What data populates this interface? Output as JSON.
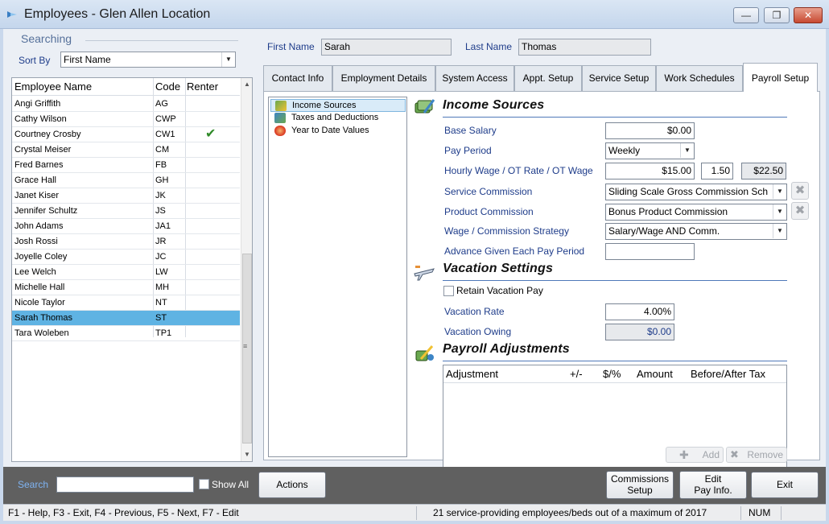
{
  "window": {
    "title": "Employees - Glen Allen Location",
    "minimize": "—",
    "maximize": "❐",
    "close": "✕"
  },
  "search_panel": {
    "group_label": "Searching",
    "sort_by_label": "Sort By",
    "sort_by_value": "First Name"
  },
  "employee_grid": {
    "columns": [
      "Employee Name",
      "Code",
      "Renter"
    ],
    "rows": [
      {
        "name": "Angi Griffith",
        "code": "AG",
        "renter": false
      },
      {
        "name": "Cathy Wilson",
        "code": "CWP",
        "renter": false
      },
      {
        "name": "Courtney Crosby",
        "code": "CW1",
        "renter": true
      },
      {
        "name": "Crystal Meiser",
        "code": "CM",
        "renter": false
      },
      {
        "name": "Fred Barnes",
        "code": "FB",
        "renter": false
      },
      {
        "name": "Grace Hall",
        "code": "GH",
        "renter": false
      },
      {
        "name": "Janet Kiser",
        "code": "JK",
        "renter": false
      },
      {
        "name": "Jennifer Schultz",
        "code": "JS",
        "renter": false
      },
      {
        "name": "John Adams",
        "code": "JA1",
        "renter": false
      },
      {
        "name": "Josh Rossi",
        "code": "JR",
        "renter": false
      },
      {
        "name": "Joyelle Coley",
        "code": "JC",
        "renter": false
      },
      {
        "name": "Lee Welch",
        "code": "LW",
        "renter": false
      },
      {
        "name": "Michelle Hall",
        "code": "MH",
        "renter": false
      },
      {
        "name": "Nicole Taylor",
        "code": "NT",
        "renter": false
      },
      {
        "name": "Sarah Thomas",
        "code": "ST",
        "renter": false,
        "selected": true
      },
      {
        "name": "Tara Woleben",
        "code": "TP1",
        "renter": false
      }
    ],
    "renter_mark": "✔"
  },
  "employee": {
    "first_name_label": "First Name",
    "first_name": "Sarah",
    "last_name_label": "Last Name",
    "last_name": "Thomas"
  },
  "tabs": [
    {
      "label": "Contact Info"
    },
    {
      "label": "Employment Details"
    },
    {
      "label": "System Access"
    },
    {
      "label": "Appt. Setup"
    },
    {
      "label": "Service Setup"
    },
    {
      "label": "Work Schedules"
    },
    {
      "label": "Payroll Setup",
      "active": true
    }
  ],
  "payroll_tree": [
    {
      "label": "Income Sources",
      "icon": "money-icon",
      "selected": true
    },
    {
      "label": "Taxes and Deductions",
      "icon": "tax-icon"
    },
    {
      "label": "Year to Date Values",
      "icon": "ytd-icon"
    }
  ],
  "income_sources": {
    "title": "Income Sources",
    "base_salary_label": "Base Salary",
    "base_salary": "$0.00",
    "pay_period_label": "Pay Period",
    "pay_period": "Weekly",
    "hourly_label": "Hourly Wage / OT Rate / OT Wage",
    "hourly_wage": "$15.00",
    "ot_rate": "1.50",
    "ot_wage": "$22.50",
    "service_commission_label": "Service Commission",
    "service_commission": "Sliding Scale Gross Commission Sch",
    "product_commission_label": "Product Commission",
    "product_commission": "Bonus Product Commission",
    "strategy_label": "Wage / Commission Strategy",
    "strategy": "Salary/Wage AND Comm.",
    "advance_label": "Advance Given Each Pay Period",
    "advance": ""
  },
  "vacation": {
    "title": "Vacation Settings",
    "retain_label": "Retain Vacation Pay",
    "retain_checked": false,
    "rate_label": "Vacation Rate",
    "rate": "4.00%",
    "owing_label": "Vacation Owing",
    "owing": "$0.00"
  },
  "adjustments": {
    "title": "Payroll Adjustments",
    "columns": [
      "Adjustment",
      "+/-",
      "$/%",
      "Amount",
      "Before/After Tax"
    ],
    "add_label": "Add",
    "remove_label": "Remove"
  },
  "bottom_bar": {
    "search_label": "Search",
    "search_value": "",
    "show_all_label": "Show All",
    "actions_label": "Actions",
    "commissions_setup_line1": "Commissions",
    "commissions_setup_line2": "Setup",
    "edit_pay_line1": "Edit",
    "edit_pay_line2": "Pay Info.",
    "exit_label": "Exit"
  },
  "status_bar": {
    "hotkeys": "F1 - Help, F3 - Exit, F4 - Previous, F5 - Next, F7 - Edit",
    "message": "21 service-providing employees/beds out of a maximum of 2017",
    "num": "NUM"
  },
  "colors": {
    "label_blue": "#1e3c8a",
    "selection": "#5fb3e3",
    "section_line": "#4f79b9",
    "check_green": "#2f8a28"
  }
}
